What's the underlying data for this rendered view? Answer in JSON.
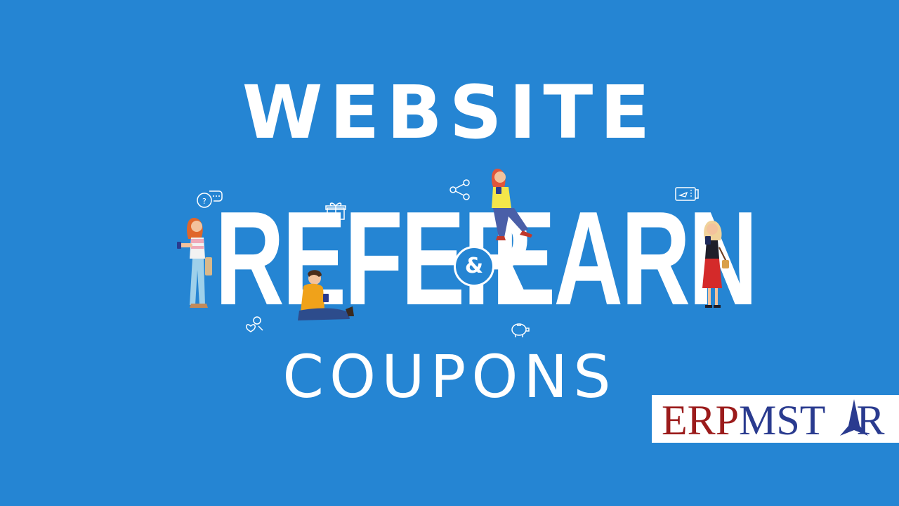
{
  "headline": {
    "top": "WEBSITE",
    "middle_left": "REFER",
    "ampersand": "&",
    "middle_right": "EARN",
    "bottom": "COUPONS"
  },
  "logo": {
    "part_erp": "ERP",
    "part_m": "M",
    "part_st": "ST",
    "part_r": "R"
  },
  "colors": {
    "background": "#2585d3",
    "text": "#ffffff",
    "logo_red": "#9b1b1b",
    "logo_blue": "#2a3b8f"
  },
  "icons": [
    "chat-bubbles-icon",
    "gift-icon",
    "share-icon",
    "ticket-icon",
    "profile-heart-icon",
    "piggy-bank-icon"
  ]
}
